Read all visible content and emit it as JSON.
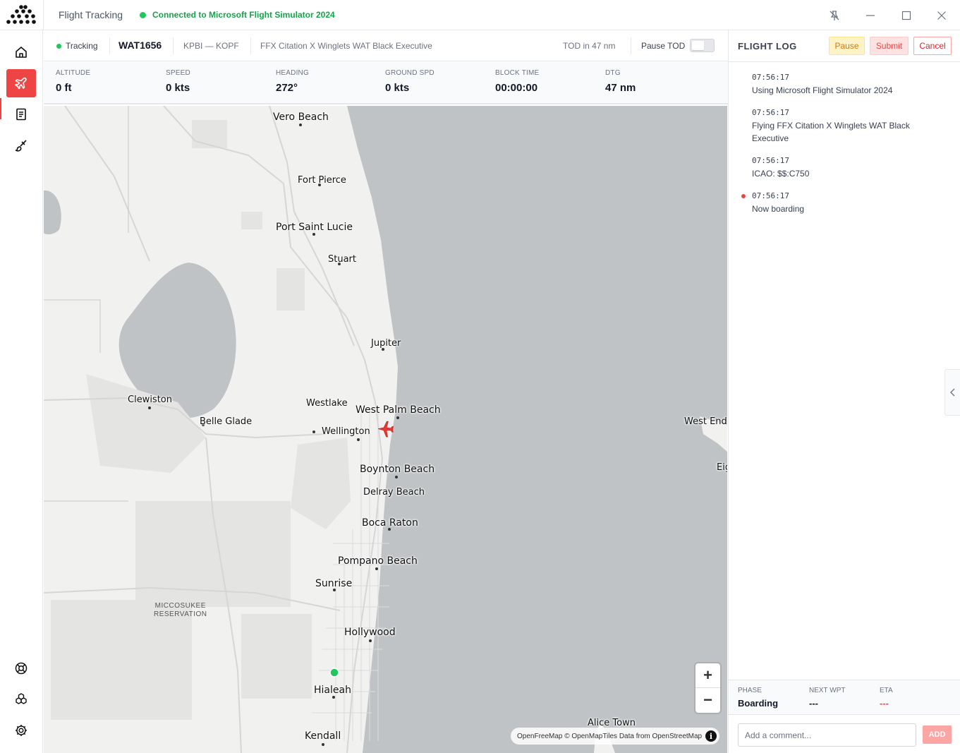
{
  "app": {
    "title": "Flight Tracking",
    "connection_status": "Connected to Microsoft Flight Simulator 2024"
  },
  "window_controls": [
    "pin-off-icon",
    "minimize-icon",
    "maximize-icon",
    "close-icon"
  ],
  "sidebar": {
    "items": [
      {
        "name": "home",
        "icon": "home-icon",
        "active": false
      },
      {
        "name": "flight-tracking",
        "icon": "plane-icon",
        "active": true
      },
      {
        "name": "logbook",
        "icon": "book-icon",
        "active": false
      },
      {
        "name": "liveries",
        "icon": "paintbrush-icon",
        "active": false
      }
    ],
    "bottom_items": [
      {
        "name": "support",
        "icon": "lifebuoy-icon"
      },
      {
        "name": "addons",
        "icon": "cubes-icon"
      },
      {
        "name": "settings",
        "icon": "gear-icon"
      }
    ]
  },
  "flight": {
    "tracking_label": "Tracking",
    "callsign": "WAT1656",
    "route": "KPBI — KOPF",
    "aircraft": "FFX Citation X Winglets WAT Black Executive",
    "tod": "TOD in 47 nm",
    "pause_tod_label": "Pause TOD",
    "pause_tod_enabled": false
  },
  "stats": [
    {
      "label": "ALTITUDE",
      "value": "0 ft"
    },
    {
      "label": "SPEED",
      "value": "0 kts"
    },
    {
      "label": "HEADING",
      "value": "272°"
    },
    {
      "label": "GROUND SPD",
      "value": "0 kts"
    },
    {
      "label": "BLOCK TIME",
      "value": "00:00:00"
    },
    {
      "label": "DTG",
      "value": "47 nm"
    }
  ],
  "map": {
    "places": {
      "vero_beach": "Vero Beach",
      "fort_pierce": "Fort Pierce",
      "port_saint_lucie": "Port Saint Lucie",
      "stuart": "Stuart",
      "jupiter": "Jupiter",
      "clewiston": "Clewiston",
      "belle_glade": "Belle Glade",
      "westlake": "Westlake",
      "west_palm_beach": "West Palm Beach",
      "wellington": "Wellington",
      "west_end": "West End",
      "eight_mile_rock": "Eig",
      "boynton_beach": "Boynton Beach",
      "delray_beach": "Delray Beach",
      "boca_raton": "Boca Raton",
      "pompano_beach": "Pompano Beach",
      "sunrise": "Sunrise",
      "hollywood": "Hollywood",
      "hialeah": "Hialeah",
      "kendall": "Kendall",
      "alice_town": "Alice Town",
      "miccosukee_1": "MICCOSUKEE",
      "miccosukee_2": "RESERVATION"
    },
    "zoom_in": "+",
    "zoom_out": "−",
    "attribution": "OpenFreeMap © OpenMapTiles Data from OpenStreetMap",
    "info": "i",
    "colors": {
      "water": "#bfc3c5",
      "land": "#f1f1f0",
      "aircraft": "#e53935",
      "destination": "#22c55e"
    }
  },
  "flight_log": {
    "title": "FLIGHT LOG",
    "buttons": {
      "pause": "Pause",
      "submit": "Submit",
      "cancel": "Cancel"
    },
    "entries": [
      {
        "time": "07:56:17",
        "message": "Using Microsoft Flight Simulator 2024"
      },
      {
        "time": "07:56:17",
        "message": "Flying FFX Citation X Winglets WAT Black Executive"
      },
      {
        "time": "07:56:17",
        "message": "ICAO: $$:C750"
      },
      {
        "time": "07:56:17",
        "message": "Now boarding"
      }
    ]
  },
  "phase_bar": {
    "phase_label": "PHASE",
    "phase_value": "Boarding",
    "next_wpt_label": "NEXT WPT",
    "next_wpt_value": "---",
    "eta_label": "ETA",
    "eta_value": "---"
  },
  "comment": {
    "placeholder": "Add a comment...",
    "add_label": "ADD"
  }
}
